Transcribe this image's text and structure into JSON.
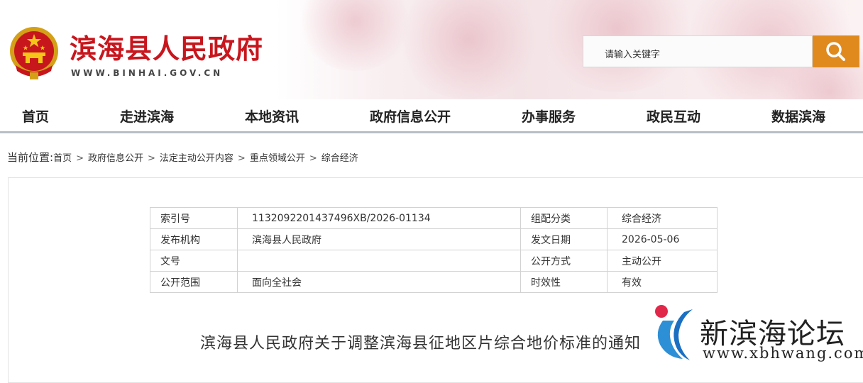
{
  "header": {
    "site_title": "滨海县人民政府",
    "site_url": "WWW.BINHAI.GOV.CN",
    "search_placeholder": "请输入关键字"
  },
  "nav": {
    "items": [
      "首页",
      "走进滨海",
      "本地资讯",
      "政府信息公开",
      "办事服务",
      "政民互动",
      "数据滨海"
    ]
  },
  "breadcrumb": {
    "lead": "当前位置:",
    "items": [
      "首页",
      "政府信息公开",
      "法定主动公开内容",
      "重点领域公开",
      "综合经济"
    ],
    "separator": ">"
  },
  "meta_table": {
    "rows": [
      {
        "k1": "索引号",
        "v1": "1132092201437496XB/2026-01134",
        "k2": "组配分类",
        "v2": "综合经济"
      },
      {
        "k1": "发布机构",
        "v1": "滨海县人民政府",
        "k2": "发文日期",
        "v2": "2026-05-06"
      },
      {
        "k1": "文号",
        "v1": "",
        "k2": "公开方式",
        "v2": "主动公开"
      },
      {
        "k1": "公开范围",
        "v1": "面向全社会",
        "k2": "时效性",
        "v2": "有效"
      }
    ]
  },
  "article": {
    "title": "滨海县人民政府关于调整滨海县征地区片综合地价标准的通知"
  },
  "watermark": {
    "name": "新滨海论坛",
    "url": "www.xbhwang.com"
  },
  "colors": {
    "brand_red": "#c8161d",
    "search_orange": "#e08a1e",
    "nav_underline": "#b7bec6"
  }
}
